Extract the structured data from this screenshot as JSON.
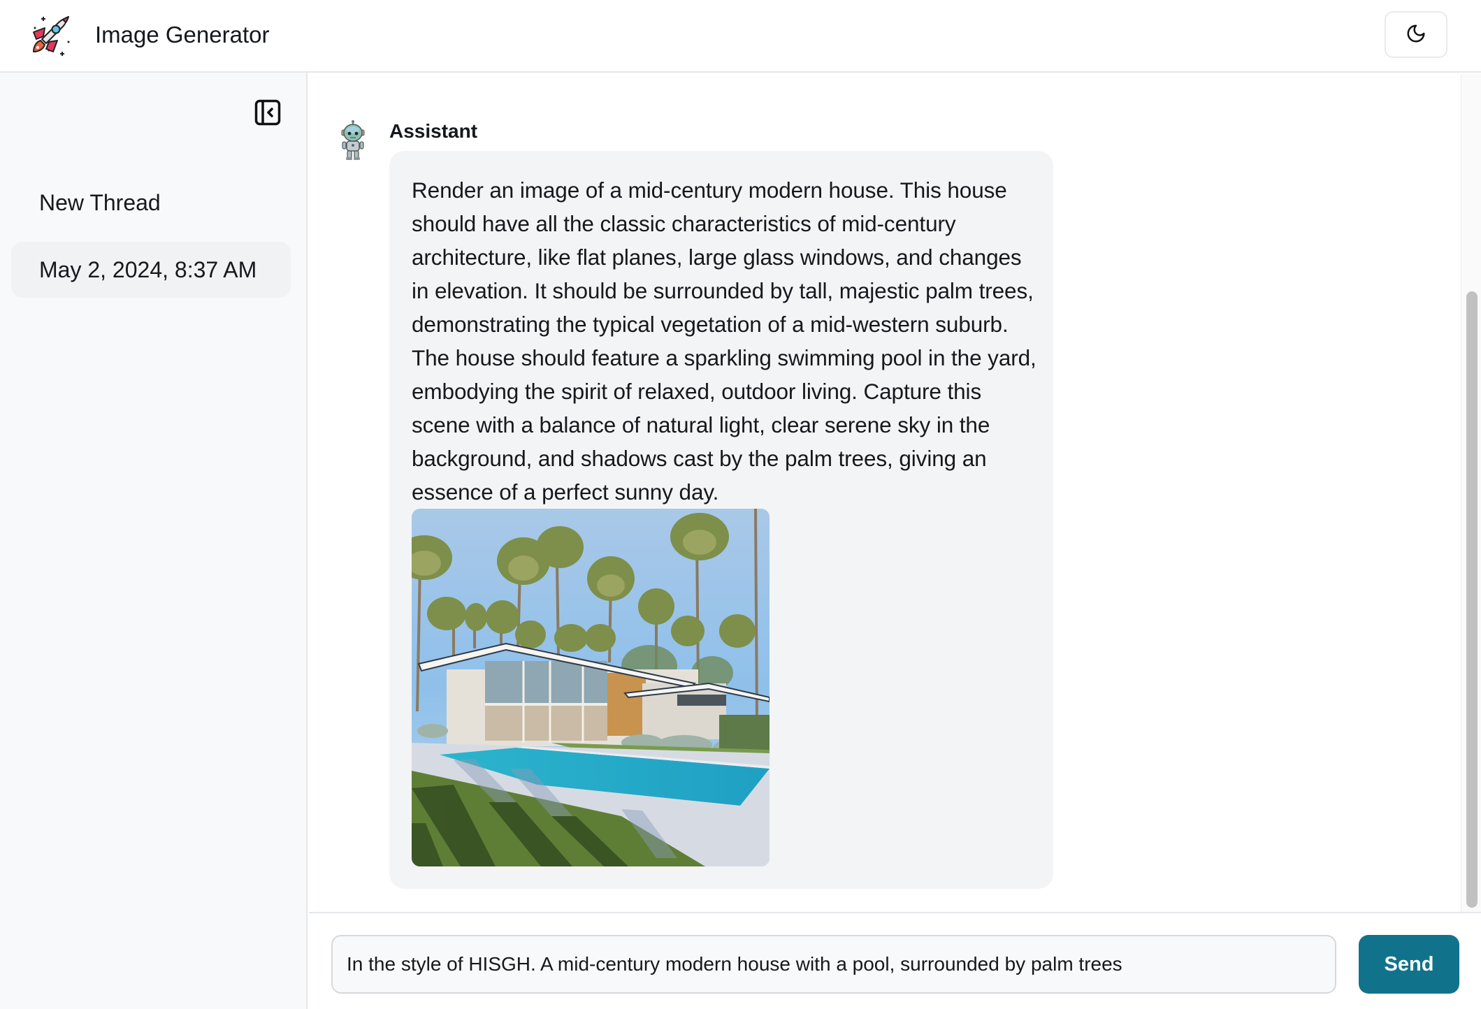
{
  "app": {
    "title": "Image Generator",
    "logo_icon": "rocket-icon",
    "theme_toggle_icon": "moon-icon"
  },
  "sidebar": {
    "collapse_icon": "sidebar-collapse-icon",
    "new_thread_label": "New Thread",
    "threads": [
      {
        "label": "May 2, 2024, 8:37 AM",
        "active": true
      }
    ]
  },
  "chat": {
    "messages": [
      {
        "sender": "Assistant",
        "avatar_icon": "robot-avatar-icon",
        "text": "Render an image of a mid-century modern house. This house should have all the classic characteristics of mid-century architecture, like flat planes, large glass windows, and changes in elevation. It should be surrounded by tall, majestic palm trees, demonstrating the typical vegetation of a mid-western suburb. The house should feature a sparkling swimming pool in the yard, embodying the spirit of relaxed, outdoor living. Capture this scene with a balance of natural light, clear serene sky in the background, and shadows cast by the palm trees, giving an essence of a perfect sunny day.",
        "image_alt": "Generated image of a mid-century modern house with a swimming pool surrounded by tall palm trees"
      }
    ]
  },
  "composer": {
    "input_value": "In the style of HISGH. A mid-century modern house with a pool, surrounded by palm trees",
    "send_label": "Send"
  },
  "colors": {
    "accent": "#11738b",
    "bubble_bg": "#f3f4f6",
    "sidebar_bg": "#f8f9fb",
    "active_thread_bg": "#f0f2f4"
  }
}
